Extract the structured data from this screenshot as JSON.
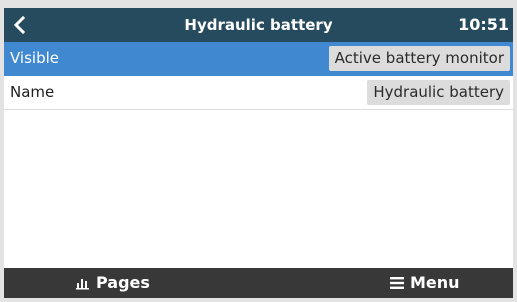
{
  "header": {
    "title": "Hydraulic battery",
    "time": "10:51"
  },
  "rows": [
    {
      "label": "Visible",
      "value": "Active battery monitor"
    },
    {
      "label": "Name",
      "value": "Hydraulic battery"
    }
  ],
  "footer": {
    "pages_label": "Pages",
    "menu_label": "Menu",
    "pages_icon": "bar-chart-icon",
    "menu_icon": "hamburger-icon"
  },
  "colors": {
    "header_bg": "#274b5e",
    "selected_row_bg": "#4089d0",
    "value_pill_bg": "#dcdcdc",
    "footer_bg": "#383838"
  }
}
